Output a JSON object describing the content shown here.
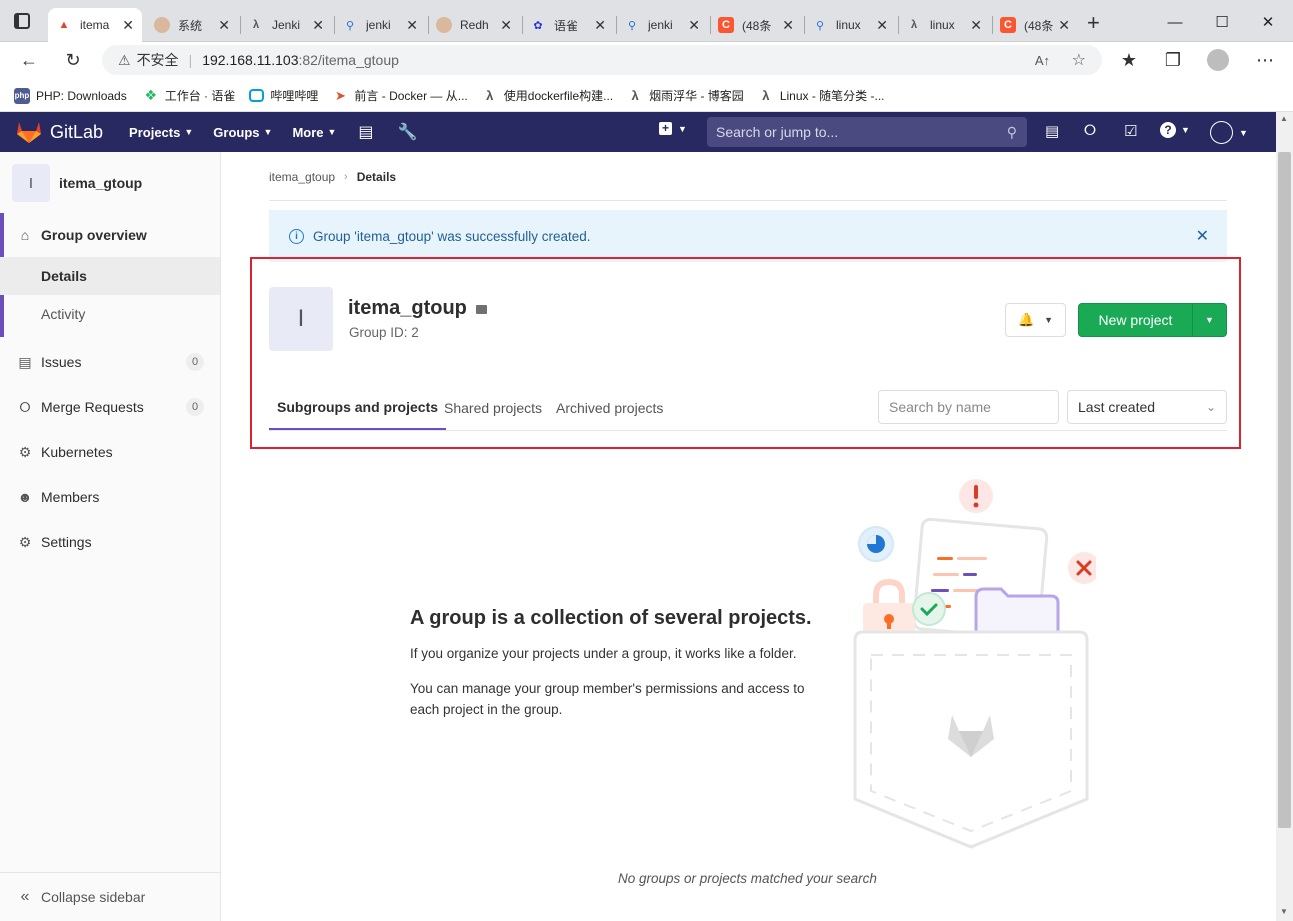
{
  "browser": {
    "tabs": [
      {
        "title": "itema",
        "icon": "gitlab-icon"
      },
      {
        "title": "系统",
        "icon": "jenkins-icon"
      },
      {
        "title": "Jenki",
        "icon": "yuque-icon"
      },
      {
        "title": "jenki",
        "icon": "search-icon"
      },
      {
        "title": "Redh",
        "icon": "jenkins-icon"
      },
      {
        "title": "语雀",
        "icon": "baidu-icon"
      },
      {
        "title": "jenki",
        "icon": "search-icon"
      },
      {
        "title": "(48条",
        "icon": "csdn-icon"
      },
      {
        "title": "linux",
        "icon": "search-icon"
      },
      {
        "title": "linux",
        "icon": "yuque-icon"
      },
      {
        "title": "(48条",
        "icon": "csdn-icon"
      }
    ],
    "insecure_label": "不安全",
    "url_host": "192.168.11.103",
    "url_rest": ":82/itema_gtoup",
    "bookmarks": [
      {
        "label": "PHP: Downloads",
        "icon": "php"
      },
      {
        "label": "工作台 · 语雀",
        "icon": "yuque"
      },
      {
        "label": "哔哩哔哩",
        "icon": "bilibili"
      },
      {
        "label": "前言 - Docker — 从...",
        "icon": "rocket"
      },
      {
        "label": "使用dockerfile构建...",
        "icon": "yuque"
      },
      {
        "label": "烟雨浮华 - 博客园",
        "icon": "yuque"
      },
      {
        "label": "Linux - 随笔分类 -...",
        "icon": "yuque"
      }
    ],
    "tab_icon_letters": {
      "csdn": "C",
      "php": "php"
    }
  },
  "header": {
    "brand": "GitLab",
    "nav": [
      "Projects",
      "Groups",
      "More"
    ],
    "search_placeholder": "Search or jump to..."
  },
  "sidebar": {
    "group_letter": "I",
    "group_name": "itema_gtoup",
    "overview": "Group overview",
    "details": "Details",
    "activity": "Activity",
    "issues": "Issues",
    "issues_count": "0",
    "merge_requests": "Merge Requests",
    "mr_count": "0",
    "kubernetes": "Kubernetes",
    "members": "Members",
    "settings": "Settings",
    "collapse": "Collapse sidebar"
  },
  "breadcrumb": {
    "group": "itema_gtoup",
    "current": "Details"
  },
  "flash": {
    "message": "Group 'itema_gtoup' was successfully created."
  },
  "group": {
    "letter": "I",
    "name": "itema_gtoup",
    "id_text": "Group ID: 2",
    "new_project": "New project"
  },
  "tabs": {
    "subgroups": "Subgroups and projects",
    "shared": "Shared projects",
    "archived": "Archived projects",
    "search_placeholder": "Search by name",
    "sort": "Last created"
  },
  "empty": {
    "title": "A group is a collection of several projects.",
    "line1": "If you organize your projects under a group, it works like a folder.",
    "line2": "You can manage your group member's permissions and access to each project in the group.",
    "footer": "No groups or projects matched your search"
  },
  "colors": {
    "gitlab_nav": "#292961",
    "primary_green": "#1aaa55",
    "flash_bg": "#e8f4fc",
    "annotation_red": "#d9232e",
    "active_tab_underline": "#6b4fbb"
  }
}
